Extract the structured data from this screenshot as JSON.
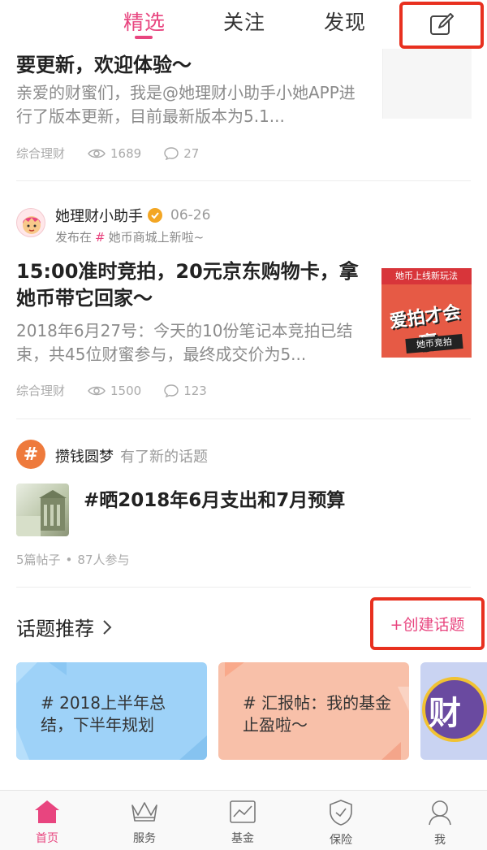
{
  "tabs": [
    {
      "label": "精选"
    },
    {
      "label": "关注"
    },
    {
      "label": "发现"
    }
  ],
  "post1": {
    "title": "要更新，欢迎体验～",
    "excerpt": "亲爱的财蜜们，我是@她理财小助手小她APP进行了版本更新，目前最新版本为5.1...",
    "category": "综合理财",
    "views": "1689",
    "comments": "27"
  },
  "post2": {
    "author": "她理财小助手",
    "date": "06-26",
    "posted_in_prefix": "发布在",
    "topic": "她币商城上新啦~",
    "title": "15:00准时竞拍，20元京东购物卡，拿她币带它回家～",
    "excerpt": "2018年6月27号：今天的10份笔记本竞拍已结束，共45位财蜜参与，最终成交价为5...",
    "category": "综合理财",
    "views": "1500",
    "comments": "123",
    "thumb": {
      "banner": "她币上线新玩法",
      "big": "爱拍才会赢",
      "sub": "她币竞拍"
    }
  },
  "topic_activity": {
    "user": "攒钱圆梦",
    "action": "有了新的话题",
    "title": "#晒2018年6月支出和7月预算",
    "posts": "5篇帖子",
    "participants": "87人参与"
  },
  "recommend": {
    "heading": "话题推荐",
    "create_label": "+创建话题",
    "cards": [
      {
        "text": "# 2018上半年总结，下半年规划",
        "color": "#9ed2f8"
      },
      {
        "text": "# 汇报帖：我的基金止盈啦～",
        "color": "#f8c0a9"
      },
      {
        "text": "财",
        "color": "#c9d3f2"
      }
    ]
  },
  "bottom_nav": [
    {
      "label": "首页",
      "icon": "home-icon"
    },
    {
      "label": "服务",
      "icon": "crown-icon"
    },
    {
      "label": "基金",
      "icon": "chart-icon"
    },
    {
      "label": "保险",
      "icon": "shield-icon"
    },
    {
      "label": "我",
      "icon": "user-icon"
    }
  ],
  "colors": {
    "accent": "#e8457f",
    "highlight_box": "#e8301f"
  }
}
